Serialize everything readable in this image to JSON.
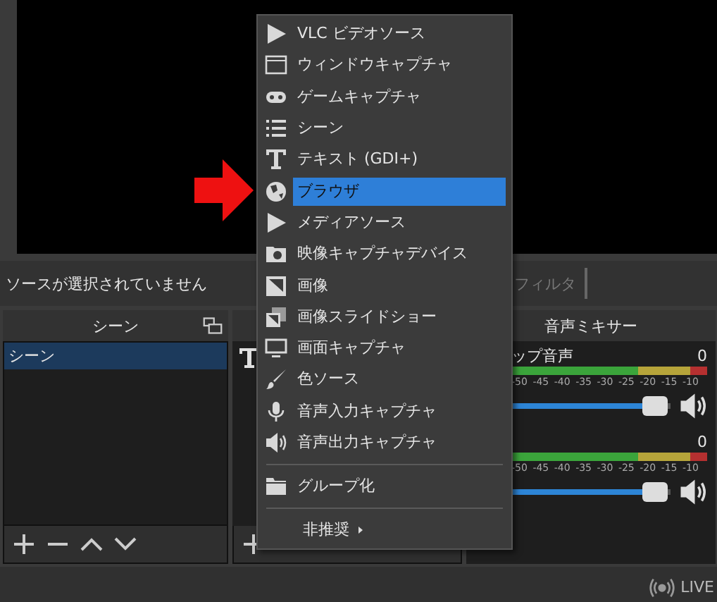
{
  "status_bar": {
    "no_source": "ソースが選択されていません",
    "filter_button": {
      "label": "フィルタ",
      "disabled": true
    }
  },
  "scenes": {
    "title": "シーン",
    "items": [
      {
        "label": "シーン",
        "selected": true
      }
    ]
  },
  "mixer": {
    "title": "音声ミキサー",
    "channels": [
      {
        "name": "ップ音声",
        "reading": "0",
        "scale": [
          "-50",
          "-45",
          "-40",
          "-35",
          "-30",
          "-25",
          "-20",
          "-15",
          "-10"
        ],
        "level": 0.9,
        "muted": false
      },
      {
        "reading": "0",
        "scale": [
          "-50",
          "-45",
          "-40",
          "-35",
          "-30",
          "-25",
          "-20",
          "-15",
          "-10"
        ],
        "level": 0.9,
        "muted": false
      }
    ]
  },
  "footer": {
    "live": "LIVE"
  },
  "context_menu": {
    "items": [
      {
        "kind": "item",
        "label": "VLC ビデオソース",
        "selected": false
      },
      {
        "kind": "item",
        "label": "ウィンドウキャプチャ",
        "selected": false
      },
      {
        "kind": "item",
        "label": "ゲームキャプチャ",
        "selected": false
      },
      {
        "kind": "item",
        "label": "シーン",
        "selected": false
      },
      {
        "kind": "item",
        "label": "テキスト (GDI+)",
        "selected": false
      },
      {
        "kind": "item",
        "label": "ブラウザ",
        "selected": true
      },
      {
        "kind": "item",
        "label": "メディアソース",
        "selected": false
      },
      {
        "kind": "item",
        "label": "映像キャプチャデバイス",
        "selected": false
      },
      {
        "kind": "item",
        "label": "画像",
        "selected": false
      },
      {
        "kind": "item",
        "label": "画像スライドショー",
        "selected": false
      },
      {
        "kind": "item",
        "label": "画面キャプチャ",
        "selected": false
      },
      {
        "kind": "item",
        "label": "色ソース",
        "selected": false
      },
      {
        "kind": "item",
        "label": "音声入力キャプチャ",
        "selected": false
      },
      {
        "kind": "item",
        "label": "音声出力キャプチャ",
        "selected": false
      },
      {
        "kind": "separator"
      },
      {
        "kind": "item",
        "label": "グループ化",
        "selected": false
      },
      {
        "kind": "separator"
      },
      {
        "kind": "submenu",
        "label": "非推奨",
        "selected": false
      }
    ]
  }
}
